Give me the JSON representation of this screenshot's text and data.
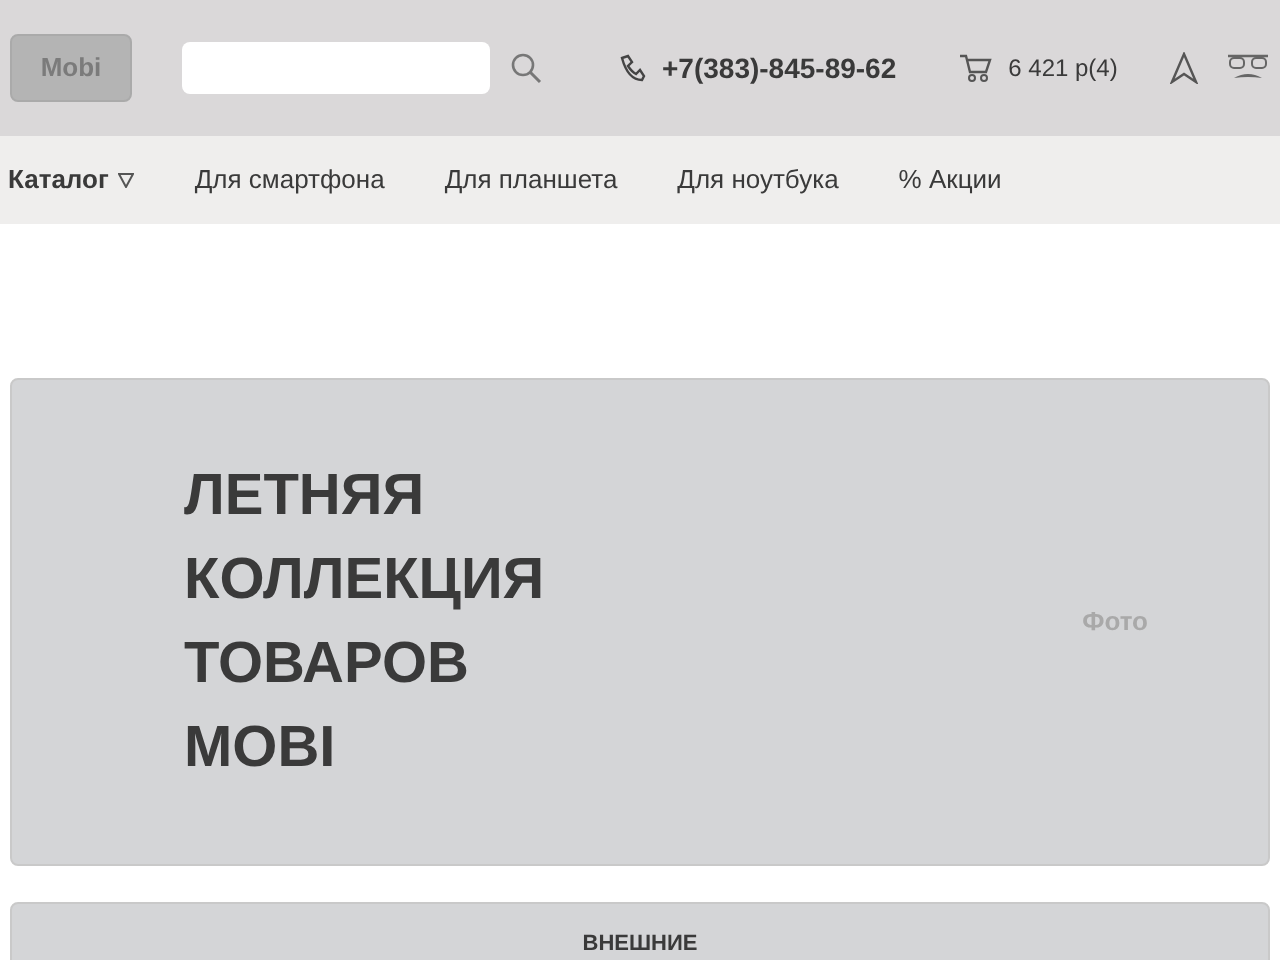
{
  "header": {
    "logo": "Mobi",
    "phone": "+7(383)-845-89-62",
    "cart": "6 421 р(4)"
  },
  "nav": [
    {
      "label": "Каталог",
      "kind": "dropdown"
    },
    {
      "label": "Для смартфона",
      "kind": "link"
    },
    {
      "label": "Для планшета",
      "kind": "link"
    },
    {
      "label": "Для ноутбука",
      "kind": "link"
    },
    {
      "label": "% Акции",
      "kind": "link"
    }
  ],
  "banner": {
    "title_lines": [
      "ЛЕТНЯЯ",
      "КОЛЛЕКЦИЯ",
      "ТОВАРОВ",
      "MOBI"
    ],
    "photo_label": "Фото"
  },
  "next_card": {
    "title": "ВНЕШНИЕ"
  }
}
